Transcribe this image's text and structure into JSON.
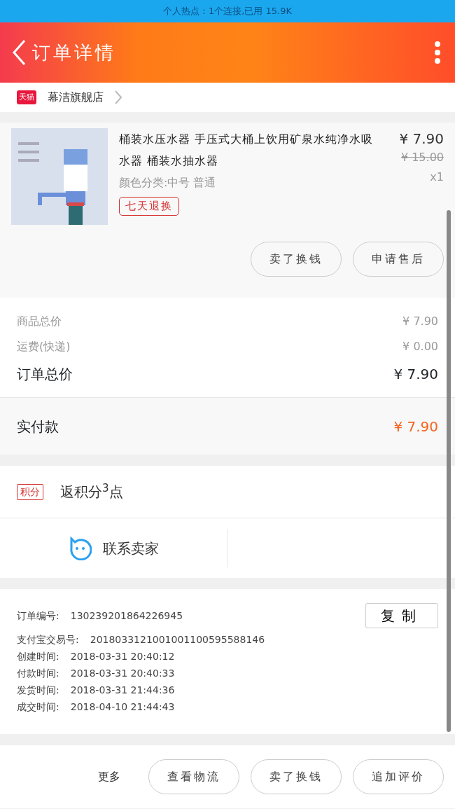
{
  "status_bar": {
    "text": "个人热点：1个连接,已用 15.9K"
  },
  "header": {
    "title": "订单详情"
  },
  "shop": {
    "name": "幕洁旗舰店",
    "badge": "天猫"
  },
  "product": {
    "image": {
      "kind": "picture"
    },
    "title": "桶装水压水器 手压式大桶上饮用矿泉水纯净水吸水器 桶装水抽水器",
    "variant": "颜色分类:中号 普通",
    "price": "¥ 7.90",
    "original_price": "¥ 15.00",
    "quantity": "x1",
    "tag": "七天退换",
    "actions": [
      "卖了换钱",
      "申请售后"
    ]
  },
  "summary": [
    {
      "label": "商品总价",
      "value": "¥ 7.90",
      "kind": "minor"
    },
    {
      "label": "运费(快递)",
      "value": "¥ 0.00",
      "kind": "minor"
    },
    {
      "label": "订单总价",
      "value": "¥ 7.90",
      "kind": "major"
    }
  ],
  "paid": {
    "label": "实付款",
    "value": "¥ 7.90"
  },
  "points": {
    "badge": "积分",
    "text": "返积分$^{3}$点"
  },
  "contact": {
    "label": "联系卖家"
  },
  "order_info": {
    "copy_button": "复制",
    "fields": [
      {
        "label": "订单编号:",
        "value": "130239201864226945"
      },
      {
        "label": "支付宝交易号:",
        "value": "2018033121001001100595588146"
      },
      {
        "label": "创建时间:",
        "value": "2018-03-31 20:40:12"
      },
      {
        "label": "付款时间:",
        "value": "2018-03-31 20:40:33"
      },
      {
        "label": "发货时间:",
        "value": "2018-03-31 21:44:36"
      },
      {
        "label": "成交时间:",
        "value": "2018-04-10 21:44:43"
      }
    ]
  },
  "bottom_bar": {
    "more": "更多",
    "buttons": [
      "查看物流",
      "卖了换钱",
      "追加评价"
    ]
  }
}
